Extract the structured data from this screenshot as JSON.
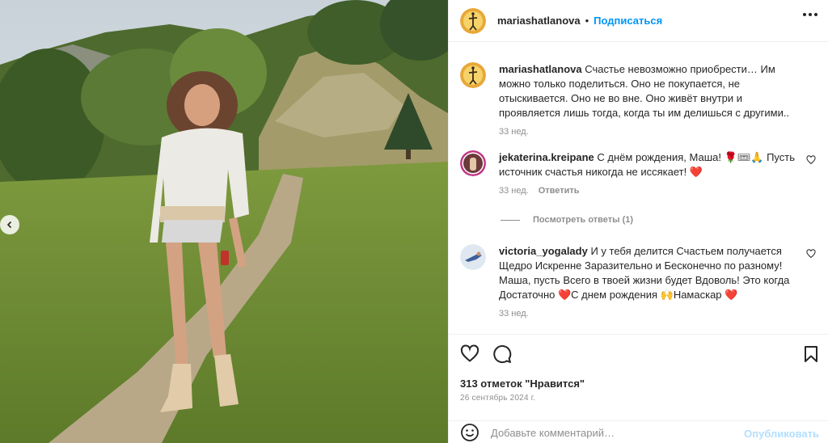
{
  "post": {
    "username": "mariashatlanova",
    "follow_label": "Подписаться",
    "more_icon": "more-horizontal-icon"
  },
  "caption": {
    "username": "mariashatlanova",
    "text": "Счастье невозможно приобрести… Им можно только поделиться. Оно не покупается, не отыскивается. Оно не во вне. Оно живёт внутри и проявляется лишь тогда, когда ты им делишься с другими..",
    "time": "33 нед."
  },
  "comments": [
    {
      "username": "jekaterina.kreipane",
      "text": "С днём рождения, Маша! 🌹🎟🙏 Пусть источник счастья никогда не иссякает! ❤️",
      "time": "33 нед.",
      "reply_label": "Ответить"
    },
    {
      "username": "victoria_yogalady",
      "text": "И у тебя делится Счастьем получается Щедро Искренне Заразительно и Бесконечно по разному! Маша, пусть Всего в твоей жизни будет Вдоволь! Это когда Достаточно ❤️С днем рождения 🙌Намаскар ❤️",
      "time": "33 нед."
    }
  ],
  "view_replies_label": "Посмотреть ответы (1)",
  "likes_text": "313 отметок \"Нравится\"",
  "date_text": "26 сентябрь 2024 г.",
  "add_comment": {
    "placeholder": "Добавьте комментарий…",
    "publish_label": "Опубликовать"
  },
  "colors": {
    "accent": "#0095f6",
    "muted": "#8e8e8e",
    "publish_disabled": "#b2dffc"
  }
}
